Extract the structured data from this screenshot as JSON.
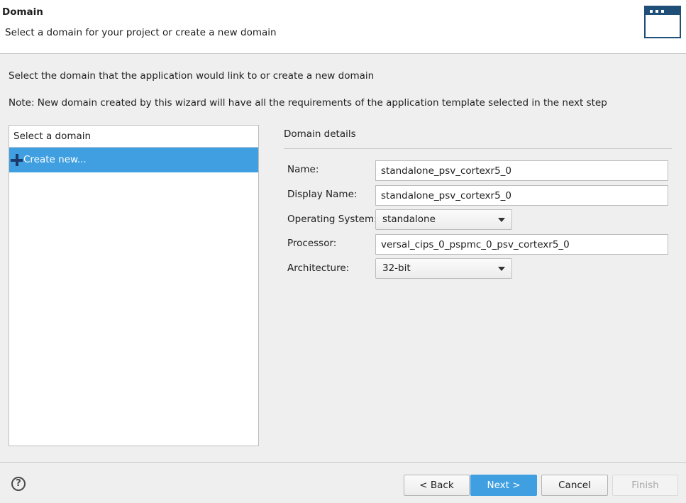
{
  "header": {
    "title": "Domain",
    "subtitle": "Select a domain for your project or create a new domain",
    "icon": "window-icon"
  },
  "intro_text": "Select the domain that the application would link to or create a new domain",
  "note_text": "Note: New domain created by this wizard will have all the requirements of the application template selected in the next step",
  "domain_list": {
    "header": "Select a domain",
    "items": [
      {
        "label": "Create new...",
        "icon": "plus-icon",
        "selected": true
      }
    ]
  },
  "details": {
    "title": "Domain details",
    "name": {
      "label": "Name:",
      "value": "standalone_psv_cortexr5_0"
    },
    "display_name": {
      "label": "Display Name:",
      "value": "standalone_psv_cortexr5_0"
    },
    "os": {
      "label": "Operating System:",
      "value": "standalone"
    },
    "processor": {
      "label": "Processor:",
      "value": "versal_cips_0_pspmc_0_psv_cortexr5_0"
    },
    "architecture": {
      "label": "Architecture:",
      "value": "32-bit"
    }
  },
  "footer": {
    "help_glyph": "?",
    "back_label": "< Back",
    "next_label": "Next >",
    "cancel_label": "Cancel",
    "finish_label": "Finish"
  },
  "colors": {
    "accent": "#3f9fe0",
    "icon_dark": "#1b3a6b",
    "icon_frame": "#1f4e79"
  }
}
